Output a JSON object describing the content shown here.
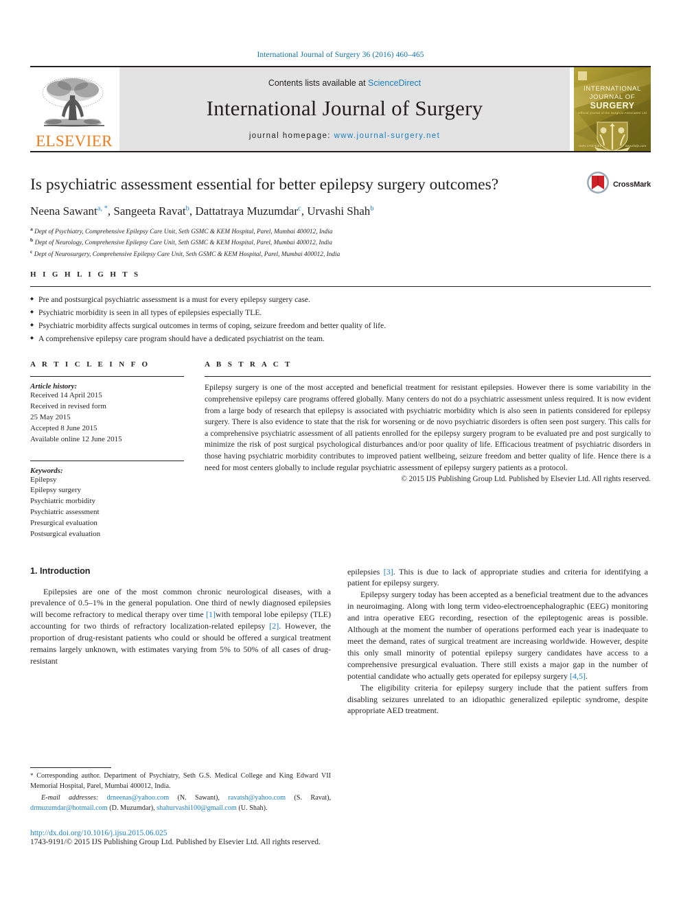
{
  "running_head": "International Journal of Surgery 36 (2016) 460–465",
  "masthead": {
    "publisher_logo_text": "ELSEVIER",
    "contents_prefix": "Contents lists available at ",
    "contents_link": "ScienceDirect",
    "journal_title": "International Journal of Surgery",
    "homepage_prefix": "journal homepage: ",
    "homepage_url": "www.journal-surgery.net",
    "cover": {
      "line1": "INTERNATIONAL",
      "line2": "JOURNAL OF",
      "line3": "SURGERY",
      "line4": "Official journal of the Surgical Associates Ltd",
      "foot_left": "ISSN 1743-9191",
      "foot_right": "www.theijs.com"
    }
  },
  "article": {
    "title": "Is psychiatric assessment essential for better epilepsy surgery outcomes?",
    "authors": [
      {
        "name": "Neena Sawant",
        "marks": "a, *"
      },
      {
        "name": "Sangeeta Ravat",
        "marks": "b"
      },
      {
        "name": "Dattatraya Muzumdar",
        "marks": "c"
      },
      {
        "name": "Urvashi Shah",
        "marks": "b"
      }
    ],
    "affiliations": [
      {
        "mark": "a",
        "text": "Dept of Psychiatry, Comprehensive Epilepsy Care Unit, Seth GSMC & KEM Hospital, Parel, Mumbai 400012, India"
      },
      {
        "mark": "b",
        "text": "Dept of Neurology, Comprehensive Epilepsy Care Unit, Seth GSMC & KEM Hospital, Parel, Mumbai 400012, India"
      },
      {
        "mark": "c",
        "text": "Dept of Neurosurgery, Comprehensive Epilepsy Care Unit, Seth GSMC & KEM Hospital, Parel, Mumbai 400012, India"
      }
    ],
    "crossmark_label": "CrossMark"
  },
  "highlights": {
    "heading": "H I G H L I G H T S",
    "items": [
      "Pre and postsurgical psychiatric assessment is a must for every epilepsy surgery case.",
      "Psychiatric morbidity is seen in all types of epilepsies especially TLE.",
      "Psychiatric morbidity affects surgical outcomes in terms of coping, seizure freedom and better quality of life.",
      "A comprehensive epilepsy care program should have a dedicated psychiatrist on the team."
    ]
  },
  "article_info": {
    "heading": "A R T I C L E  I N F O",
    "history_label": "Article history:",
    "history": [
      "Received 14 April 2015",
      "Received in revised form",
      "25 May 2015",
      "Accepted 8 June 2015",
      "Available online 12 June 2015"
    ],
    "keywords_label": "Keywords:",
    "keywords": [
      "Epilepsy",
      "Epilepsy surgery",
      "Psychiatric morbidity",
      "Psychiatric assessment",
      "Presurgical evaluation",
      "Postsurgical evaluation"
    ]
  },
  "abstract": {
    "heading": "A B S T R A C T",
    "text": "Epilepsy surgery is one of the most accepted and beneficial treatment for resistant epilepsies. However there is some variability in the comprehensive epilepsy care programs offered globally. Many centers do not do a psychiatric assessment unless required. It is now evident from a large body of research that epilepsy is associated with psychiatric morbidity which is also seen in patients considered for epilepsy surgery. There is also evidence to state that the risk for worsening or de novo psychiatric disorders is often seen post surgery. This calls for a comprehensive psychiatric assessment of all patients enrolled for the epilepsy surgery program to be evaluated pre and post surgically to minimize the risk of post surgical psychological disturbances and/or poor quality of life. Efficacious treatment of psychiatric disorders in those having psychiatric morbidity contributes to improved patient wellbeing, seizure freedom and better quality of life. Hence there is a need for most centers globally to include regular psychiatric assessment of epilepsy surgery patients as a protocol.",
    "copyright": "© 2015 IJS Publishing Group Ltd. Published by Elsevier Ltd. All rights reserved."
  },
  "body": {
    "section_heading": "1. Introduction",
    "left_paragraph_1_a": "Epilepsies are one of the most common chronic neurological diseases, with a prevalence of 0.5–1% in the general population. One third of newly diagnosed epilepsies will become refractory to medical therapy over time ",
    "left_cite_1": "[1]",
    "left_paragraph_1_b": "with temporal lobe epilepsy (TLE) accounting for two thirds of refractory localization-related epilepsy ",
    "left_cite_2": "[2]",
    "left_paragraph_1_c": ". However, the proportion of drug-resistant patients who could or should be offered a surgical treatment remains largely unknown, with estimates varying from 5% to 50% of all cases of drug-resistant",
    "right_paragraph_1_a": "epilepsies ",
    "right_cite_3": "[3]",
    "right_paragraph_1_b": ". This is due to lack of appropriate studies and criteria for identifying a patient for epilepsy surgery.",
    "right_paragraph_2_a": "Epilepsy surgery today has been accepted as a beneficial treatment due to the advances in neuroimaging. Along with long term video-electroencephalographic (EEG) monitoring and intra operative EEG recording, resection of the epileptogenic areas is possible. Although at the moment the number of operations performed each year is inadequate to meet the demand, rates of surgical treatment are increasing worldwide. However, despite this only small minority of potential epilepsy surgery candidates have access to a comprehensive presurgical evaluation. There still exists a major gap in the number of potential candidate who actually gets operated for epilepsy surgery ",
    "right_cite_45": "[4,5]",
    "right_paragraph_2_b": ".",
    "right_paragraph_3": "The eligibility criteria for epilepsy surgery include that the patient suffers from disabling seizures unrelated to an idiopathic generalized epileptic syndrome, despite appropriate AED treatment."
  },
  "footnotes": {
    "corresponding_marker": "*",
    "corresponding_text": " Corresponding author. Department of Psychiatry, Seth G.S. Medical College and King Edward VII Memorial Hospital, Parel, Mumbai 400012, India.",
    "email_label": "E-mail addresses:",
    "emails": [
      {
        "address": "drneenas@yahoo.com",
        "person": "(N. Sawant),"
      },
      {
        "address": "ravatsh@yahoo.com",
        "person": "(S. Ravat),"
      },
      {
        "address": "drmuzumdar@hotmail.com",
        "person": "(D. Muzumdar),"
      },
      {
        "address": "shahurvashi100@gmail.com",
        "person": "(U. Shah)."
      }
    ]
  },
  "footer": {
    "doi": "http://dx.doi.org/10.1016/j.ijsu.2015.06.025",
    "issn_line": "1743-9191/© 2015 IJS Publishing Group Ltd. Published by Elsevier Ltd. All rights reserved."
  },
  "colors": {
    "link_blue": "#1b7fc4",
    "running_head_blue": "#1070a8",
    "elsevier_orange": "#f07c1a",
    "band_gray": "#e3e3e3"
  }
}
